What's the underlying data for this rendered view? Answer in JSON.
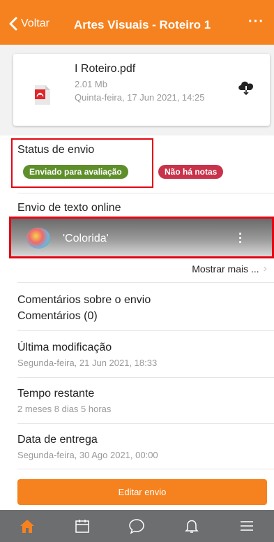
{
  "header": {
    "back_label": "Voltar",
    "title": "Artes Visuais - Roteiro 1",
    "more_label": "···"
  },
  "file": {
    "name": "I Roteiro.pdf",
    "size": "2.01 Mb",
    "date": "Quinta-feira, 17 Jun 2021, 14:25",
    "icon": "pdf-icon",
    "download_icon": "cloud-download-icon"
  },
  "status": {
    "heading": "Status de envio",
    "badge_submitted": "Enviado para avaliação",
    "badge_grade": "Não há notas"
  },
  "online_text": {
    "heading": "Envio de texto online",
    "item_label": "'Colorida'",
    "show_more": "Mostrar mais ..."
  },
  "comments": {
    "heading": "Comentários sobre o envio",
    "count_label": "Comentários (0)"
  },
  "last_modified": {
    "heading": "Última modificação",
    "value": "Segunda-feira, 21 Jun 2021, 18:33"
  },
  "time_remaining": {
    "heading": "Tempo restante",
    "value": "2 meses 8 dias 5 horas"
  },
  "due_date": {
    "heading": "Data de entrega",
    "value": "Segunda-feira, 30 Ago 2021, 00:00"
  },
  "edit_button": "Editar envio",
  "tabs": [
    "home-icon",
    "calendar-icon",
    "chat-icon",
    "bell-icon",
    "menu-icon"
  ],
  "colors": {
    "accent": "#f5821f",
    "badge_green": "#5e8f2a",
    "badge_red": "#c8324a",
    "tabbar": "#6d6e70",
    "highlight_box": "#e30613"
  }
}
